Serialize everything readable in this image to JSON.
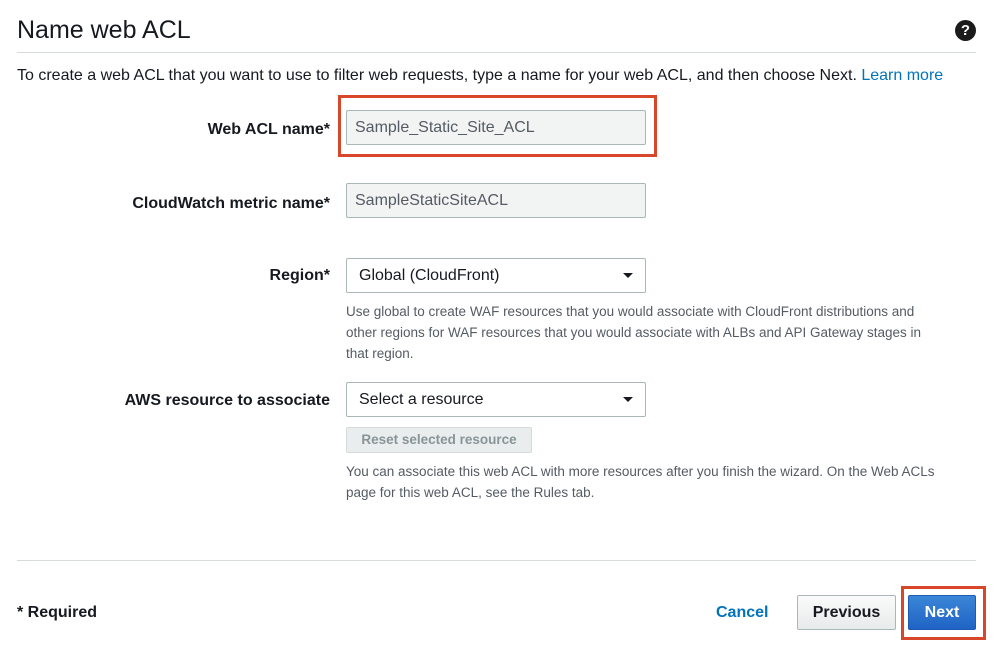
{
  "page": {
    "title": "Name web ACL",
    "intro_text": "To create a web ACL that you want to use to filter web requests, type a name for your web ACL, and then choose Next.",
    "learn_more": "Learn more"
  },
  "form": {
    "acl_name": {
      "label": "Web ACL name*",
      "value": "Sample_Static_Site_ACL"
    },
    "metric_name": {
      "label": "CloudWatch metric name*",
      "value": "SampleStaticSiteACL"
    },
    "region": {
      "label": "Region*",
      "selected": "Global (CloudFront)",
      "hint_line1": "Use global to create WAF resources that you would associate with CloudFront distributions and",
      "hint_line2": "other regions for WAF resources that you would associate with ALBs and API Gateway stages in",
      "hint_line3": "that region."
    },
    "resource": {
      "label": "AWS resource to associate",
      "selected": "Select a resource",
      "reset_button": "Reset selected resource",
      "hint_line1": "You can associate this web ACL with more resources after you finish the wizard. On the Web ACLs",
      "hint_line2": "page for this web ACL, see the Rules tab."
    }
  },
  "footer": {
    "required_note": "* Required",
    "cancel": "Cancel",
    "previous": "Previous",
    "next": "Next"
  },
  "colors": {
    "highlight": "#d9472b",
    "link": "#0073bb",
    "primary_button": "#1f63c4"
  },
  "icons": {
    "help": "question-circle-icon",
    "dropdown": "caret-down-icon"
  }
}
